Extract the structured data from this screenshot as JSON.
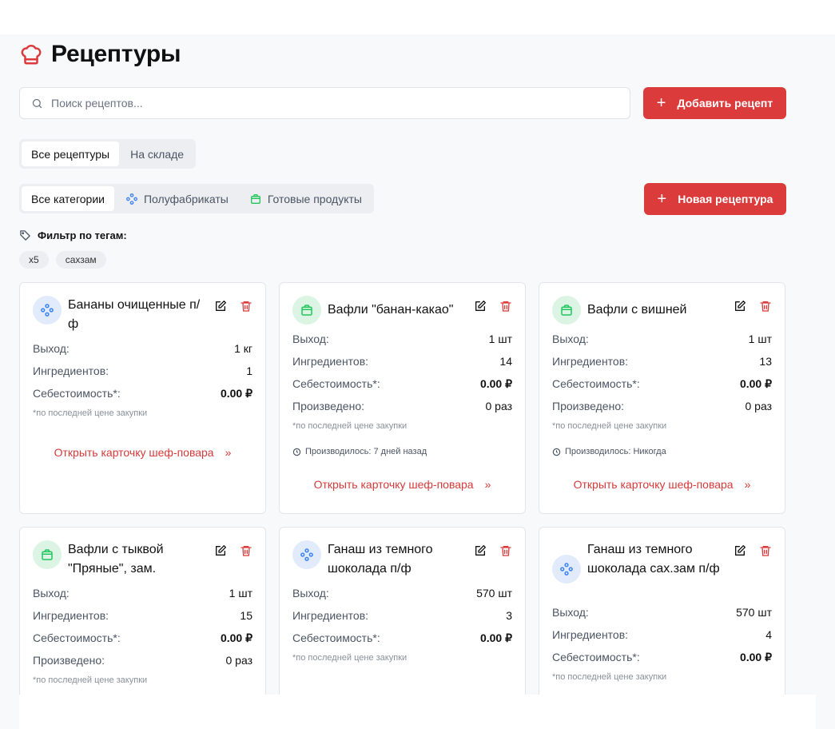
{
  "colors": {
    "accent": "#dc3b3b",
    "semi_icon": "#3b82f6",
    "ready_icon": "#22c55e"
  },
  "page": {
    "title": "Рецептуры",
    "title_icon": "chef-hat-icon"
  },
  "search": {
    "placeholder": "Поиск рецептов..."
  },
  "buttons": {
    "add_recipe": "Добавить рецепт",
    "new_recipe": "Новая рецептура"
  },
  "stock_tabs": [
    "Все рецептуры",
    "На складе"
  ],
  "category_tabs": [
    "Все категории",
    "Полуфабрикаты",
    "Готовые продукты"
  ],
  "filter": {
    "label": "Фильтр по тегам:",
    "tags": [
      "x5",
      "сахзам"
    ]
  },
  "labels": {
    "output": "Выход:",
    "ingredients": "Ингредиентов:",
    "cost": "Себестоимость*:",
    "produced": "Произведено:",
    "note": "*по последней цене закупки",
    "open_card": "Открыть карточку шеф-повара"
  },
  "cards": [
    {
      "name": "Бананы очищенные п/ф",
      "icon": "semi-product-icon",
      "output": "1 кг",
      "ingredients": "1",
      "cost": "0.00 ₽"
    },
    {
      "name": "Вафли \"банан-какао\"",
      "icon": "ready-product-icon",
      "output": "1 шт",
      "ingredients": "14",
      "cost": "0.00 ₽",
      "produced": "0 раз",
      "last_produced": "Производилось: 7 дней назад"
    },
    {
      "name": "Вафли с вишней",
      "icon": "ready-product-icon",
      "output": "1 шт",
      "ingredients": "13",
      "cost": "0.00 ₽",
      "produced": "0 раз",
      "last_produced": "Производилось: Никогда"
    },
    {
      "name": "Вафли с тыквой \"Пряные\", зам.",
      "icon": "ready-product-icon",
      "output": "1 шт",
      "ingredients": "15",
      "cost": "0.00 ₽",
      "produced": "0 раз"
    },
    {
      "name": "Ганаш из темного шоколада п/ф",
      "icon": "semi-product-icon",
      "output": "570 шт",
      "ingredients": "3",
      "cost": "0.00 ₽"
    },
    {
      "name": "Ганаш из темного шоколада сах.зам п/ф",
      "icon": "semi-product-icon",
      "output": "570 шт",
      "ingredients": "4",
      "cost": "0.00 ₽"
    }
  ]
}
